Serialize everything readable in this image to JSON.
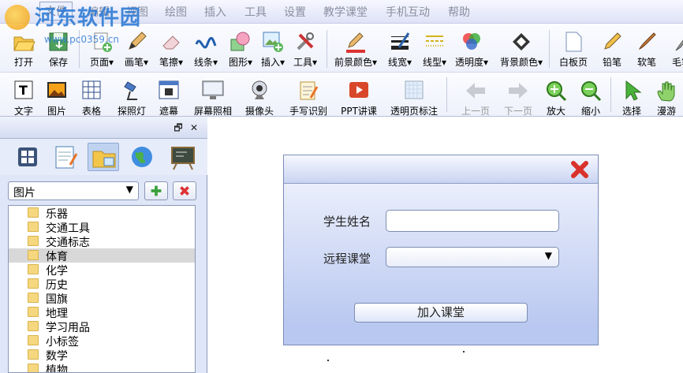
{
  "menu": [
    "文件",
    "编辑",
    "视图",
    "绘图",
    "插入",
    "工具",
    "设置",
    "教学课堂",
    "手机互动",
    "帮助"
  ],
  "watermark": {
    "text": "河东软件园",
    "url": "www.pc0359.cn"
  },
  "toolbar1": {
    "open": "打开",
    "save": "保存",
    "page": "页面",
    "pen": "画笔",
    "eraser": "笔擦",
    "line": "线条",
    "shape": "图形",
    "insert": "插入",
    "tools": "工具",
    "fg_color": "前景颜色",
    "line_width": "线宽",
    "line_style": "线型",
    "opacity": "透明度",
    "bg_color": "背景颜色",
    "whiteboard": "白板页",
    "pencil": "铅笔",
    "soft_pen": "软笔",
    "brush": "毛笔"
  },
  "toolbar2": {
    "text": "文字",
    "image": "图片",
    "table": "表格",
    "spotlight": "探照灯",
    "curtain": "遮幕",
    "screenshot": "屏幕照相",
    "camera": "摄像头",
    "handwriting": "手写识别",
    "ppt": "PPT讲课",
    "transparent": "透明页标注",
    "prev": "上一页",
    "next": "下一页",
    "zoom_in": "放大",
    "zoom_out": "缩小",
    "select": "选择",
    "roam": "漫游"
  },
  "left_panel": {
    "category": "图片",
    "tree": [
      "乐器",
      "交通工具",
      "交通标志",
      "体育",
      "化学",
      "历史",
      "国旗",
      "地理",
      "学习用品",
      "小标签",
      "数学",
      "植物"
    ],
    "selected": "体育"
  },
  "dialog": {
    "name_label": "学生姓名",
    "name_value": "",
    "class_label": "远程课堂",
    "class_value": "",
    "join_button": "加入课堂"
  }
}
